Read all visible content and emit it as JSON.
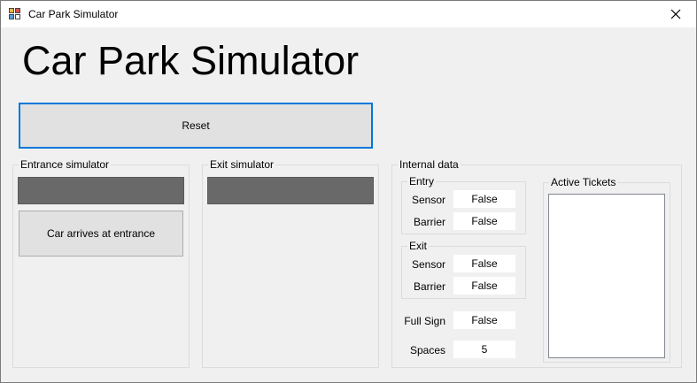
{
  "window": {
    "title": "Car Park Simulator",
    "close_glyph": "✕"
  },
  "heading": "Car Park Simulator",
  "reset_label": "Reset",
  "entrance": {
    "label": "Entrance simulator",
    "button_label": "Car arrives at entrance"
  },
  "exit": {
    "label": "Exit simulator"
  },
  "internal": {
    "label": "Internal data",
    "entry": {
      "label": "Entry",
      "sensor_label": "Sensor",
      "sensor_value": "False",
      "barrier_label": "Barrier",
      "barrier_value": "False"
    },
    "exit": {
      "label": "Exit",
      "sensor_label": "Sensor",
      "sensor_value": "False",
      "barrier_label": "Barrier",
      "barrier_value": "False"
    },
    "full_sign_label": "Full Sign",
    "full_sign_value": "False",
    "spaces_label": "Spaces",
    "spaces_value": "5",
    "tickets_label": "Active Tickets",
    "tickets": []
  },
  "colors": {
    "accent": "#0078d7",
    "indicator_bar": "#696969",
    "window_bg": "#f0f0f0"
  },
  "icons": {
    "app": "car-park-app-icon",
    "close": "close-icon"
  }
}
